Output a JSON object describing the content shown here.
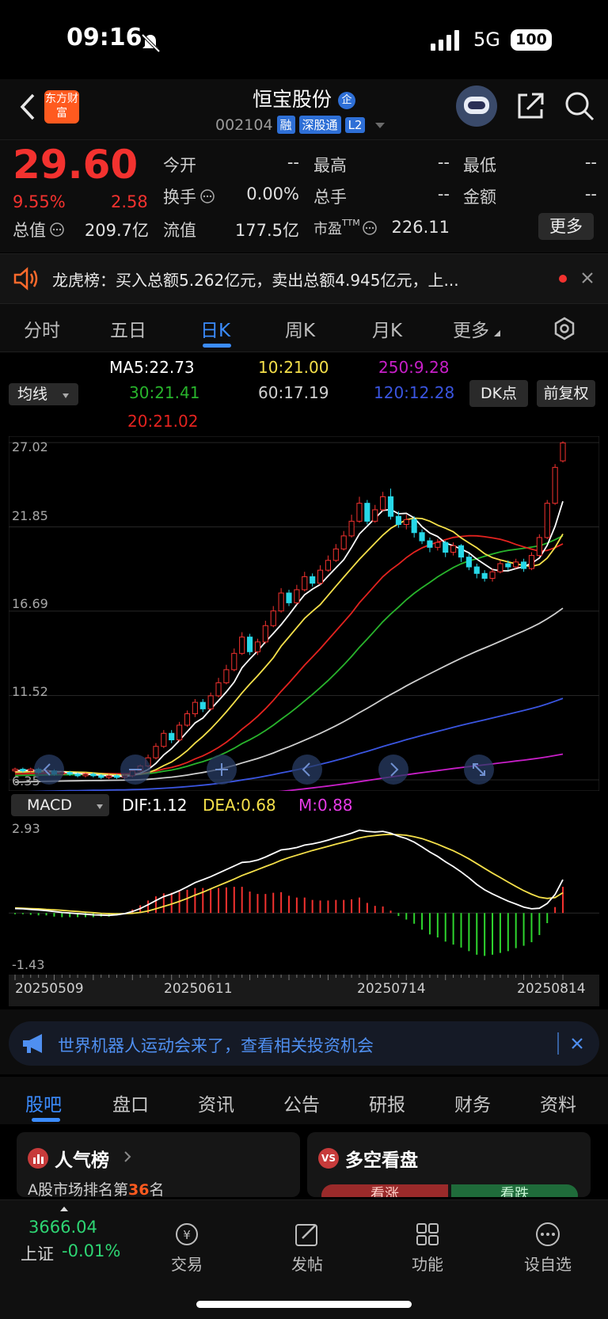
{
  "status_bar": {
    "time": "09:16",
    "network": "5G",
    "battery": "100"
  },
  "header": {
    "title": "恒宝股份",
    "badge": "企",
    "logo": "东方财富",
    "code": "002104",
    "tags": [
      "融",
      "深股通",
      "L2"
    ]
  },
  "quote": {
    "price": "29.60",
    "change_pct": "9.55%",
    "change": "2.58",
    "fields": [
      {
        "label": "今开",
        "value": "--"
      },
      {
        "label": "最高",
        "value": "--"
      },
      {
        "label": "最低",
        "value": "--"
      },
      {
        "label": "换手",
        "value": "0.00%"
      },
      {
        "label": "总手",
        "value": "--"
      },
      {
        "label": "金额",
        "value": "--"
      },
      {
        "label": "总值",
        "value": "209.7亿"
      },
      {
        "label": "流值",
        "value": "177.5亿"
      },
      {
        "label": "市盈",
        "value": "226.11"
      }
    ],
    "pe_sup": "TTM",
    "more_label": "更多"
  },
  "notice": {
    "text": "龙虎榜：买入总额5.262亿元，卖出总额4.945亿元，上..."
  },
  "kline_tabs": [
    "分时",
    "五日",
    "日K",
    "周K",
    "月K",
    "更多"
  ],
  "active_tab": 2,
  "indicators": {
    "ma_select": "均线",
    "ma5": "MA5:22.73",
    "ma10": "10:21.00",
    "ma250": "250:9.28",
    "ma30": "30:21.41",
    "ma60": "60:17.19",
    "ma120": "120:12.28",
    "ma20": "20:21.02",
    "dk_label": "DK点",
    "fq_label": "前复权",
    "macd_select": "MACD",
    "dif": "DIF:1.12",
    "dea": "DEA:0.68",
    "m": "M:0.88"
  },
  "colors": {
    "ma5": "#ffffff",
    "ma10": "#f5e04a",
    "ma20": "#e3231f",
    "ma30": "#28b42c",
    "ma60": "#cfcfcf",
    "ma120": "#3a55e0",
    "ma250": "#c81fc8",
    "up": "#f3322f",
    "down": "#27d8e8",
    "accent": "#3b8cff"
  },
  "chart_data": [
    {
      "type": "candlestick",
      "y_ticks": [
        "27.02",
        "21.85",
        "16.69",
        "11.52",
        "6.35"
      ],
      "ylim": [
        6.35,
        27.02
      ],
      "x_ticks": [
        "20250509",
        "20250611",
        "20250714",
        "20250814"
      ],
      "candles": [
        [
          6.9,
          7.0,
          6.8,
          7.1
        ],
        [
          7.0,
          6.9,
          6.8,
          7.1
        ],
        [
          6.9,
          7.0,
          6.8,
          7.1
        ],
        [
          7.0,
          6.8,
          6.7,
          7.1
        ],
        [
          6.8,
          6.9,
          6.7,
          7.0
        ],
        [
          6.9,
          6.7,
          6.6,
          7.0
        ],
        [
          6.7,
          6.8,
          6.6,
          6.9
        ],
        [
          6.8,
          6.7,
          6.6,
          6.9
        ],
        [
          6.7,
          6.6,
          6.5,
          6.8
        ],
        [
          6.6,
          6.7,
          6.5,
          6.8
        ],
        [
          6.7,
          6.6,
          6.5,
          6.8
        ],
        [
          6.6,
          6.5,
          6.4,
          6.7
        ],
        [
          6.5,
          6.6,
          6.4,
          6.7
        ],
        [
          6.6,
          6.5,
          6.4,
          6.7
        ],
        [
          6.5,
          6.6,
          6.4,
          6.7
        ],
        [
          6.6,
          6.9,
          6.5,
          7.0
        ],
        [
          6.9,
          7.2,
          6.8,
          7.3
        ],
        [
          7.2,
          7.7,
          7.1,
          7.9
        ],
        [
          7.7,
          8.4,
          7.6,
          8.6
        ],
        [
          8.4,
          9.2,
          8.3,
          9.4
        ],
        [
          9.2,
          8.8,
          8.6,
          9.4
        ],
        [
          8.8,
          9.7,
          8.7,
          9.9
        ],
        [
          9.7,
          10.4,
          9.6,
          10.6
        ],
        [
          10.4,
          11.1,
          10.2,
          11.3
        ],
        [
          11.1,
          10.7,
          10.5,
          11.3
        ],
        [
          10.7,
          11.5,
          10.6,
          11.7
        ],
        [
          11.5,
          12.3,
          11.4,
          12.6
        ],
        [
          12.3,
          13.1,
          12.2,
          13.4
        ],
        [
          13.1,
          14.1,
          13.0,
          14.4
        ],
        [
          14.1,
          15.1,
          14.0,
          15.4
        ],
        [
          15.1,
          14.2,
          14.0,
          15.3
        ],
        [
          14.2,
          14.8,
          14.0,
          15.0
        ],
        [
          14.8,
          15.8,
          14.7,
          16.1
        ],
        [
          15.8,
          16.7,
          15.7,
          17.0
        ],
        [
          16.7,
          17.8,
          16.6,
          18.1
        ],
        [
          17.8,
          17.2,
          17.0,
          18.0
        ],
        [
          17.2,
          18.0,
          17.1,
          18.3
        ],
        [
          18.0,
          18.8,
          17.9,
          19.1
        ],
        [
          18.8,
          18.4,
          18.2,
          19.0
        ],
        [
          18.4,
          19.2,
          18.3,
          19.5
        ],
        [
          19.2,
          19.8,
          19.1,
          20.1
        ],
        [
          19.8,
          20.5,
          19.7,
          20.8
        ],
        [
          20.5,
          21.3,
          20.4,
          21.6
        ],
        [
          21.3,
          22.2,
          21.2,
          22.6
        ],
        [
          22.2,
          23.3,
          22.1,
          23.7
        ],
        [
          23.3,
          22.2,
          22.0,
          23.5
        ],
        [
          22.2,
          22.9,
          22.1,
          23.2
        ],
        [
          22.9,
          23.7,
          22.8,
          24.0
        ],
        [
          23.7,
          22.5,
          22.3,
          24.2
        ],
        [
          22.5,
          22.0,
          21.8,
          22.8
        ],
        [
          22.0,
          22.3,
          21.7,
          22.6
        ],
        [
          22.3,
          21.5,
          21.2,
          22.5
        ],
        [
          21.5,
          21.0,
          20.8,
          21.7
        ],
        [
          21.0,
          20.6,
          20.3,
          21.2
        ],
        [
          20.6,
          20.9,
          20.4,
          21.1
        ],
        [
          20.9,
          20.3,
          20.0,
          21.0
        ],
        [
          20.3,
          20.7,
          20.1,
          20.9
        ],
        [
          20.7,
          20.0,
          19.7,
          20.8
        ],
        [
          20.0,
          19.4,
          19.2,
          20.2
        ],
        [
          19.4,
          19.0,
          18.7,
          19.6
        ],
        [
          19.0,
          18.7,
          18.5,
          19.2
        ],
        [
          18.7,
          19.1,
          18.5,
          19.3
        ],
        [
          19.1,
          19.6,
          19.0,
          19.8
        ],
        [
          19.6,
          19.4,
          19.2,
          19.8
        ],
        [
          19.4,
          19.7,
          19.3,
          19.9
        ],
        [
          19.7,
          19.3,
          19.1,
          19.9
        ],
        [
          19.3,
          20.1,
          19.2,
          20.3
        ],
        [
          20.1,
          21.2,
          20.0,
          21.4
        ],
        [
          21.2,
          23.3,
          21.1,
          23.5
        ],
        [
          23.3,
          25.5,
          23.2,
          25.7
        ],
        [
          25.9,
          27.0,
          25.8,
          27.1
        ]
      ]
    },
    {
      "type": "macd",
      "y_ticks": [
        "2.93",
        "-1.43"
      ],
      "ylim": [
        -1.43,
        2.93
      ],
      "dif": [
        0.15,
        0.14,
        0.12,
        0.1,
        0.08,
        0.05,
        0.02,
        0.0,
        -0.02,
        -0.04,
        -0.06,
        -0.07,
        -0.08,
        -0.06,
        -0.02,
        0.05,
        0.15,
        0.28,
        0.42,
        0.55,
        0.64,
        0.75,
        0.88,
        1.02,
        1.12,
        1.22,
        1.34,
        1.46,
        1.58,
        1.7,
        1.72,
        1.78,
        1.88,
        2.0,
        2.12,
        2.15,
        2.2,
        2.28,
        2.32,
        2.38,
        2.45,
        2.53,
        2.6,
        2.68,
        2.78,
        2.74,
        2.72,
        2.74,
        2.68,
        2.58,
        2.5,
        2.38,
        2.22,
        2.05,
        1.9,
        1.72,
        1.56,
        1.38,
        1.18,
        0.96,
        0.78,
        0.64,
        0.52,
        0.4,
        0.3,
        0.2,
        0.14,
        0.16,
        0.32,
        0.62,
        1.12
      ],
      "dea": [
        0.17,
        0.16,
        0.15,
        0.14,
        0.12,
        0.11,
        0.09,
        0.07,
        0.05,
        0.03,
        0.01,
        -0.01,
        -0.02,
        -0.03,
        -0.02,
        -0.01,
        0.02,
        0.07,
        0.14,
        0.22,
        0.3,
        0.39,
        0.49,
        0.6,
        0.7,
        0.81,
        0.92,
        1.03,
        1.14,
        1.26,
        1.36,
        1.46,
        1.56,
        1.66,
        1.77,
        1.86,
        1.94,
        2.02,
        2.1,
        2.17,
        2.24,
        2.31,
        2.38,
        2.45,
        2.52,
        2.57,
        2.6,
        2.63,
        2.64,
        2.63,
        2.61,
        2.56,
        2.5,
        2.41,
        2.31,
        2.2,
        2.09,
        1.96,
        1.82,
        1.66,
        1.5,
        1.34,
        1.19,
        1.04,
        0.89,
        0.75,
        0.63,
        0.53,
        0.49,
        0.52,
        0.68
      ],
      "m": [
        -0.04,
        -0.04,
        -0.06,
        -0.08,
        -0.08,
        -0.12,
        -0.14,
        -0.14,
        -0.14,
        -0.14,
        -0.14,
        -0.12,
        -0.12,
        -0.06,
        0.0,
        0.12,
        0.26,
        0.42,
        0.56,
        0.66,
        0.68,
        0.72,
        0.78,
        0.84,
        0.84,
        0.82,
        0.84,
        0.86,
        0.88,
        0.88,
        0.72,
        0.64,
        0.64,
        0.68,
        0.7,
        0.58,
        0.52,
        0.52,
        0.44,
        0.42,
        0.42,
        0.44,
        0.44,
        0.46,
        0.52,
        0.34,
        0.24,
        0.22,
        0.08,
        -0.1,
        -0.22,
        -0.36,
        -0.56,
        -0.72,
        -0.82,
        -0.96,
        -1.06,
        -1.16,
        -1.28,
        -1.4,
        -1.44,
        -1.4,
        -1.34,
        -1.28,
        -1.18,
        -1.1,
        -0.98,
        -0.74,
        -0.34,
        0.2,
        0.88
      ]
    }
  ],
  "banner": {
    "text": "世界机器人运动会来了，查看相关投资机会"
  },
  "bottom_tabs": [
    "股吧",
    "盘口",
    "资讯",
    "公告",
    "研报",
    "财务",
    "资料"
  ],
  "cards": {
    "left_title": "人气榜",
    "left_sub_prefix": "A股市场排名第",
    "left_rank": "36",
    "left_sub_suffix": "名",
    "right_title": "多空看盘",
    "right_left_label": "看涨",
    "right_right_label": "看跌"
  },
  "nav": {
    "index_value": "3666.04",
    "index_name": "上证",
    "index_change": "-0.01%",
    "items": [
      "交易",
      "发帖",
      "功能",
      "设自选"
    ]
  }
}
